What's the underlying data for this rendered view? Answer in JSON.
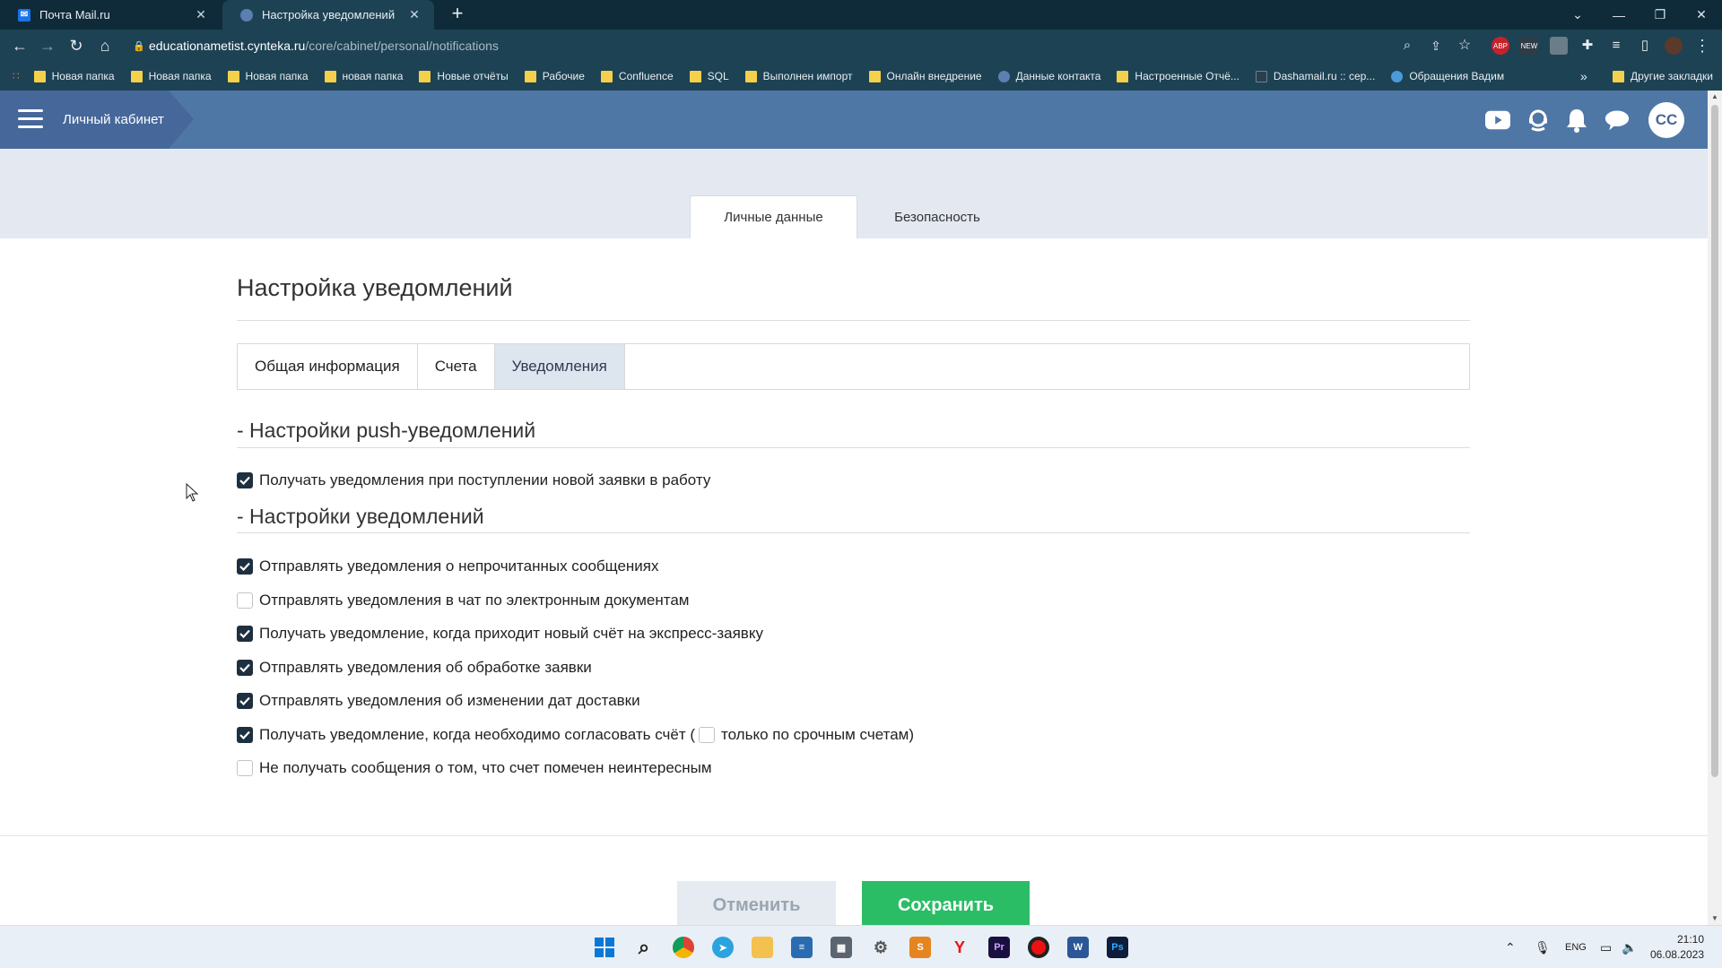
{
  "browser": {
    "tabs": [
      {
        "title": "Почта Mail.ru",
        "active": false,
        "favicon": "mail-ru-icon"
      },
      {
        "title": "Настройка уведомлений",
        "active": true,
        "favicon": "cynteka-icon"
      }
    ],
    "url_host": "educationametist.cynteka.ru",
    "url_path": "/core/cabinet/personal/notifications",
    "extensions": [
      "ABP",
      "NEW"
    ],
    "bookmarks": [
      "Новая папка",
      "Новая папка",
      "Новая папка",
      "новая папка",
      "Новые отчёты",
      "Рабочие",
      "Confluence",
      "SQL",
      "Выполнен импорт",
      "Онлайн внедрение",
      "Данные контакта",
      "Настроенные Отчё...",
      "Dashamail.ru :: сер...",
      "Обращения Вадим"
    ],
    "bookmarks_other": "Другие закладки"
  },
  "header": {
    "breadcrumb": "Личный кабинет",
    "avatar_initials": "CC"
  },
  "profile_tabs": [
    "Личные данные",
    "Безопасность"
  ],
  "page_title": "Настройка уведомлений",
  "settings_tabs": [
    "Общая информация",
    "Счета",
    "Уведомления"
  ],
  "push_section": {
    "title": "- Настройки push-уведомлений",
    "items": [
      {
        "label": "Получать уведомления при поступлении новой заявки в работу",
        "checked": true
      }
    ]
  },
  "notif_section": {
    "title": "- Настройки уведомлений",
    "items": [
      {
        "label": "Отправлять уведомления о непрочитанных сообщениях",
        "checked": true
      },
      {
        "label": "Отправлять уведомления в чат по электронным документам",
        "checked": false
      },
      {
        "label": "Получать уведомление, когда приходит новый счёт на экспресс-заявку",
        "checked": true
      },
      {
        "label": "Отправлять уведомления об обработке заявки",
        "checked": true
      },
      {
        "label": "Отправлять уведомления об изменении дат доставки",
        "checked": true
      },
      {
        "label": "Получать уведомление, когда необходимо согласовать счёт (",
        "checked": true,
        "sub_label": "только по срочным счетам)",
        "sub_checked": false
      },
      {
        "label": "Не получать сообщения о том, что счет помечен неинтересным",
        "checked": false
      }
    ]
  },
  "buttons": {
    "cancel": "Отменить",
    "save": "Сохранить"
  },
  "taskbar": {
    "lang": "ENG",
    "time": "21:10",
    "date": "06.08.2023"
  },
  "colors": {
    "header_bg": "#4f77a6",
    "save_green": "#2bbd65",
    "checkbox_checked": "#1e2f3f",
    "chrome_dark": "#0f2b3a"
  }
}
